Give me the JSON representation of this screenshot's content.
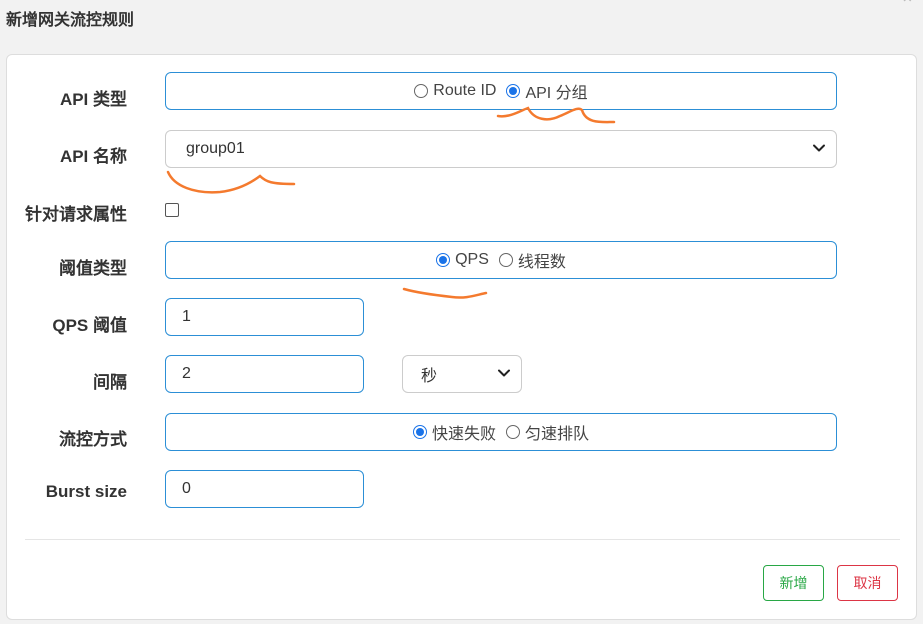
{
  "dialog": {
    "title": "新增网关流控规则"
  },
  "form": {
    "api_type": {
      "label": "API 类型",
      "options": [
        "Route ID",
        "API 分组"
      ],
      "selected": "API 分组"
    },
    "api_name": {
      "label": "API 名称",
      "value": "group01"
    },
    "request_attr": {
      "label": "针对请求属性",
      "checked": false
    },
    "threshold_type": {
      "label": "阈值类型",
      "options": [
        "QPS",
        "线程数"
      ],
      "selected": "QPS"
    },
    "qps_threshold": {
      "label": "QPS 阈值",
      "value": "1"
    },
    "interval": {
      "label": "间隔",
      "value": "2",
      "unit": "秒"
    },
    "flow_control": {
      "label": "流控方式",
      "options": [
        "快速失败",
        "匀速排队"
      ],
      "selected": "快速失败"
    },
    "burst_size": {
      "label": "Burst size",
      "value": "0"
    }
  },
  "buttons": {
    "add": "新增",
    "cancel": "取消"
  },
  "colors": {
    "accent": "#2c8fd6",
    "radio": "#1a73e8",
    "add": "#28a745",
    "cancel": "#dc3545",
    "annotation": "#f47a2e"
  }
}
